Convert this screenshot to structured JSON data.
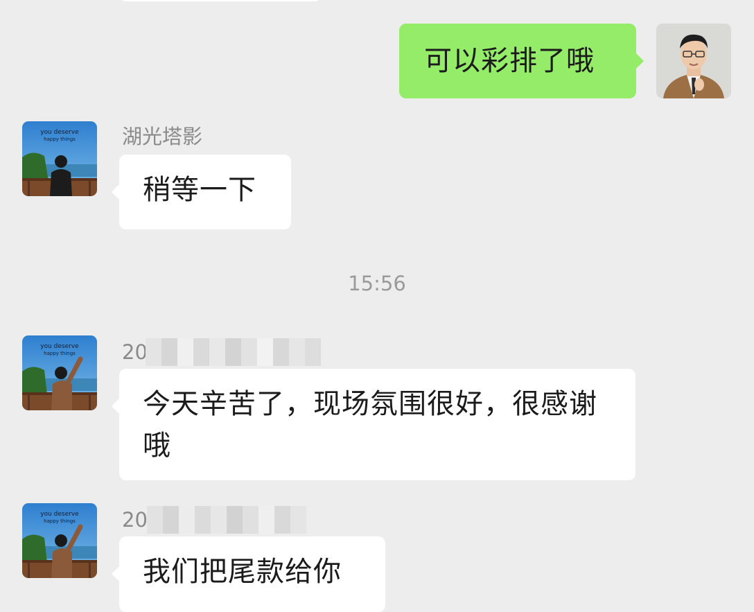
{
  "messages": [
    {
      "side": "out",
      "text": "可以彩排了哦"
    },
    {
      "side": "in",
      "sender": "湖光塔影",
      "text": "稍等一下"
    },
    {
      "side": "in",
      "sender": "20",
      "text": "今天辛苦了，现场氛围很好，很感谢哦"
    },
    {
      "side": "in",
      "sender": "20",
      "text": "我们把尾款给你"
    }
  ],
  "timestamp": "15:56",
  "avatar_caption": {
    "line1": "you deserve",
    "line2": "happy things"
  },
  "colors": {
    "background": "#ededed",
    "incoming_bubble": "#ffffff",
    "outgoing_bubble": "#95ec69",
    "text": "#1b1b1b",
    "meta_text": "#8a8a8a"
  }
}
